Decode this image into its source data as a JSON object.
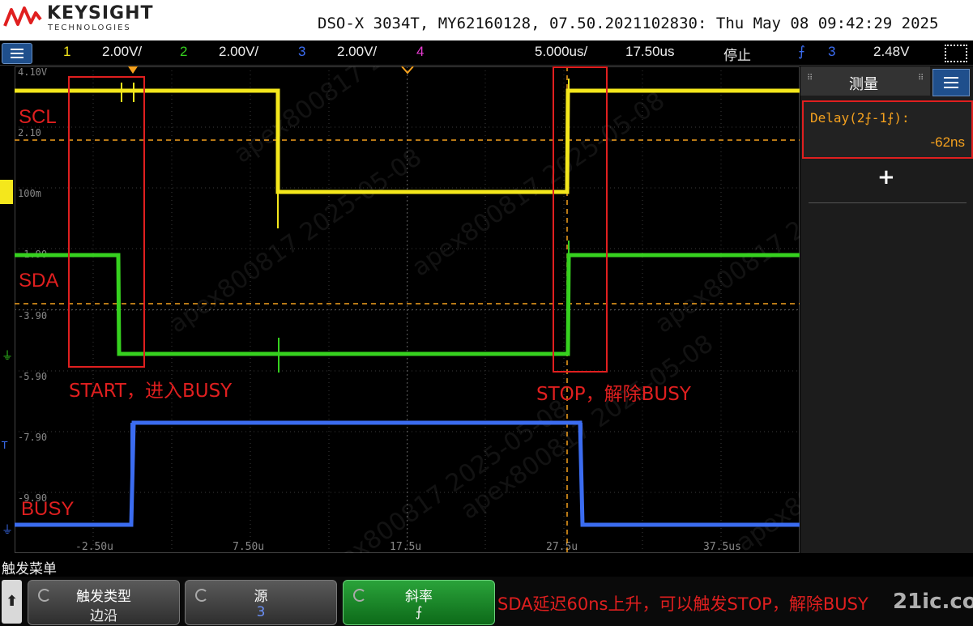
{
  "header": {
    "brand": "KEYSIGHT",
    "brand_sub": "TECHNOLOGIES",
    "instrument_info": "DSO-X 3034T, MY62160128, 07.50.2021102830: Thu May 08 09:42:29 2025"
  },
  "status_bar": {
    "ch1_num": "1",
    "ch1_scale": "2.00V/",
    "ch2_num": "2",
    "ch2_scale": "2.00V/",
    "ch3_num": "3",
    "ch3_scale": "2.00V/",
    "ch4_num": "4",
    "timebase": "5.000us/",
    "delay": "17.50us",
    "run_state": "停止",
    "trigger_source": "3",
    "trigger_level": "2.48V",
    "colors": {
      "ch1": "#f4e71c",
      "ch2": "#36d11f",
      "ch3": "#3b6cf0",
      "ch4": "#e63bd0",
      "trigger": "#f5a11e"
    }
  },
  "plot": {
    "y_labels": [
      "4.10V",
      "2.10",
      "100m",
      "-1.90",
      "-3.90",
      "-5.90",
      "-7.90",
      "-9.90"
    ],
    "x_labels": [
      "-2.50u",
      "7.50u",
      "17.5u",
      "27.5u",
      "37.5us"
    ],
    "signal_labels": {
      "scl": "SCL",
      "sda": "SDA",
      "busy": "BUSY"
    },
    "annotations": {
      "start": "START，进入BUSY",
      "stop": "STOP，解除BUSY"
    },
    "watermark": "apex800817  2025-05-08"
  },
  "measure_panel": {
    "title": "测量",
    "label": "Delay(2⨍-1⨍):",
    "value": "-62ns",
    "add_label": "+"
  },
  "menu": {
    "title": "触发菜单",
    "up_label": "⬆",
    "softkeys": [
      {
        "line1": "触发类型",
        "line2": "边沿"
      },
      {
        "line1": "源",
        "line2": "3"
      },
      {
        "line1": "斜率",
        "line2": "⨍"
      }
    ]
  },
  "bottom_note": "SDA延迟60ns上升，可以触发STOP，解除BUSY",
  "site_mark": "21ic.com"
}
